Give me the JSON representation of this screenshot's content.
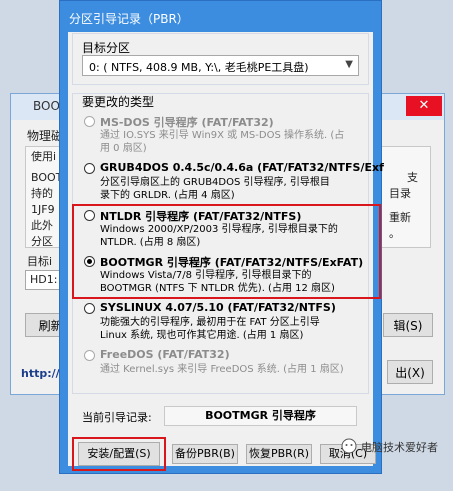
{
  "bg_window": {
    "title": "BOOT",
    "close": "✕",
    "tab": "物理磁盘",
    "group_label": "使用i",
    "text_lines": [
      "BOOT",
      "持的",
      "1JF9",
      "此外",
      "分区"
    ],
    "right_lines": [
      "支",
      "目录",
      "重新",
      "。"
    ],
    "target_label": "目标i",
    "combo_value": "HD1:",
    "refresh_button": "刷新(",
    "right_button": "辑(S)",
    "link": "http://w",
    "exit_button": "出(X)"
  },
  "dialog": {
    "title": "分区引导记录（PBR）",
    "target_label": "目标分区",
    "target_value": "0: ( NTFS, 408.9 MB, Y:\\, 老毛桃PE工具盘)",
    "type_label": "要更改的类型",
    "options": [
      {
        "title": "MS-DOS 引导程序 (FAT/FAT32)",
        "desc": [
          "通过 IO.SYS 来引导 Win9X 或 MS-DOS 操作系统. (占",
          "用 0 扇区)"
        ],
        "selected": false,
        "disabled": true
      },
      {
        "title": "GRUB4DOS 0.4.5c/0.4.6a (FAT/FAT32/NTFS/Exf",
        "desc": [
          "分区引导扇区上的 GRUB4DOS 引导程序, 引导根目",
          "录下的 GRLDR. (占用 4 扇区)"
        ],
        "selected": false,
        "disabled": false
      },
      {
        "title": "NTLDR 引导程序 (FAT/FAT32/NTFS)",
        "desc": [
          "Windows 2000/XP/2003 引导程序, 引导根目录下的",
          "NTLDR. (占用 8 扇区)"
        ],
        "selected": false,
        "disabled": false
      },
      {
        "title": "BOOTMGR 引导程序 (FAT/FAT32/NTFS/ExFAT)",
        "desc": [
          "Windows Vista/7/8 引导程序, 引导根目录下的",
          "BOOTMGR (NTFS 下 NTLDR 优先). (占用 12 扇区)"
        ],
        "selected": true,
        "disabled": false
      },
      {
        "title": "SYSLINUX 4.07/5.10 (FAT/FAT32/NTFS)",
        "desc": [
          "功能强大的引导程序, 最初用于在 FAT 分区上引导",
          "Linux 系统, 现也可作其它用途. (占用 1 扇区)"
        ],
        "selected": false,
        "disabled": false
      },
      {
        "title": "FreeDOS (FAT/FAT32)",
        "desc": [
          "通过 Kernel.sys 来引导 FreeDOS 系统. (占用 1 扇区)"
        ],
        "selected": false,
        "disabled": true
      }
    ],
    "current_label": "当前引导记录:",
    "current_value": "BOOTMGR 引导程序",
    "buttons": {
      "install": "安装/配置(S)",
      "backup": "备份PBR(B)",
      "restore": "恢复PBR(R)",
      "cancel": "取消(C)"
    }
  },
  "watermark": "电脑技术爱好者",
  "colors": {
    "title_bar": "#3c8de0",
    "highlight": "#d9161c",
    "disabled_text": "#8c8c8c"
  }
}
